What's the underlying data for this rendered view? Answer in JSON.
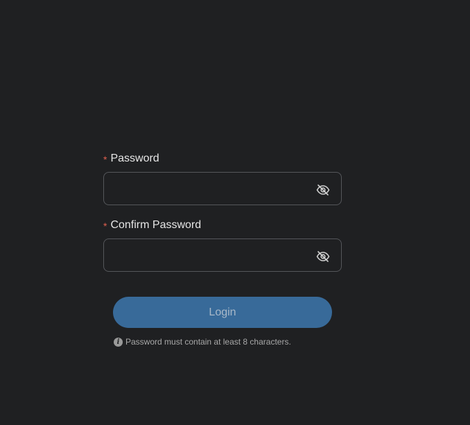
{
  "form": {
    "password": {
      "label": "Password",
      "required_mark": "*",
      "value": "",
      "placeholder": "",
      "toggle_icon": "eye-slash-icon"
    },
    "confirm_password": {
      "label": "Confirm Password",
      "required_mark": "*",
      "value": "",
      "placeholder": "",
      "toggle_icon": "eye-slash-icon"
    },
    "login_button_label": "Login",
    "hint": {
      "icon": "info-icon",
      "text": "Password must contain at least 8 characters."
    }
  },
  "colors": {
    "background": "#1f2022",
    "button": "#386a99",
    "required": "#e0604f",
    "input_border": "#55575b"
  }
}
